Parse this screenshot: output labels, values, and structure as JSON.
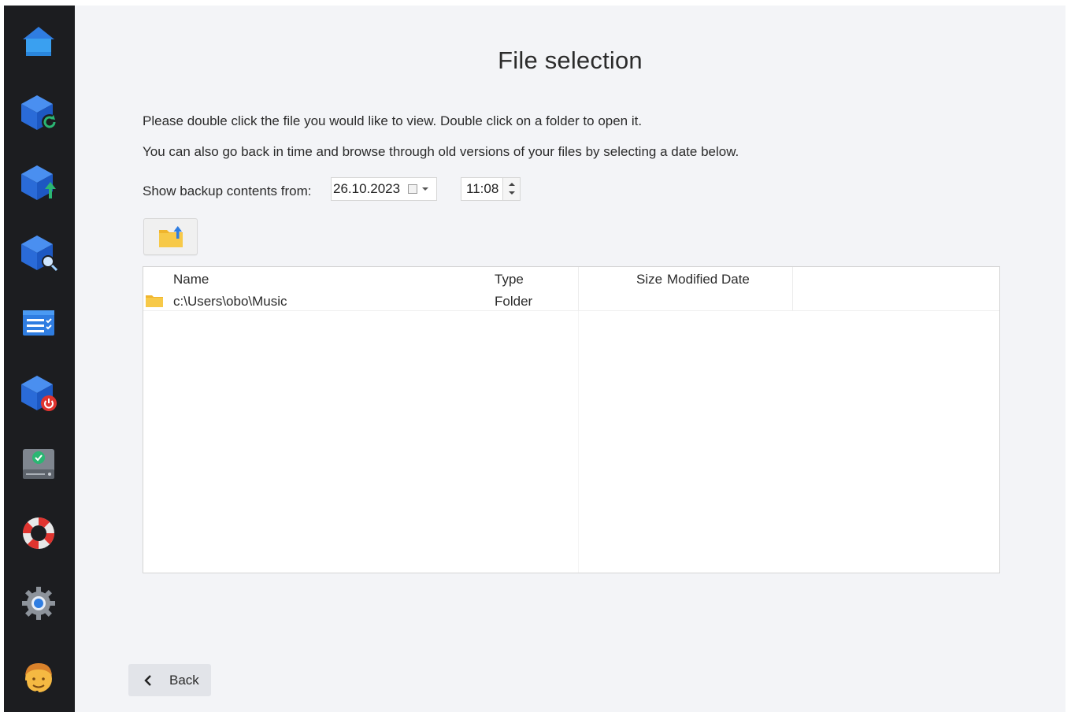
{
  "page": {
    "title": "File selection",
    "instruction_1": "Please double click the file you would like to view. Double click on a folder to open it.",
    "instruction_2": "You can also go back in time and browse through old versions of your files by selecting a date below."
  },
  "backup_selector": {
    "label": "Show backup contents from:",
    "date": "26.10.2023",
    "time": "11:08"
  },
  "table": {
    "columns": [
      "Name",
      "Type",
      "Size",
      "Modified Date"
    ],
    "rows": [
      {
        "name": "c:\\Users\\obo\\Music",
        "type": "Folder",
        "size": "",
        "modified": ""
      }
    ]
  },
  "footer": {
    "back_label": "Back"
  },
  "sidebar": {
    "items": [
      {
        "icon": "home-icon"
      },
      {
        "icon": "backup-restore-icon"
      },
      {
        "icon": "backup-upload-icon"
      },
      {
        "icon": "backup-search-icon"
      },
      {
        "icon": "task-list-icon"
      },
      {
        "icon": "backup-power-icon"
      },
      {
        "icon": "drive-check-icon"
      },
      {
        "icon": "lifebuoy-icon"
      },
      {
        "icon": "settings-gear-icon"
      },
      {
        "icon": "user-avatar-icon"
      }
    ]
  },
  "colors": {
    "sidebar_bg": "#1c1d20",
    "content_bg": "#f3f4f7",
    "accent_blue": "#2f7de1",
    "accent_green": "#2bb673",
    "accent_red": "#e0342f"
  }
}
